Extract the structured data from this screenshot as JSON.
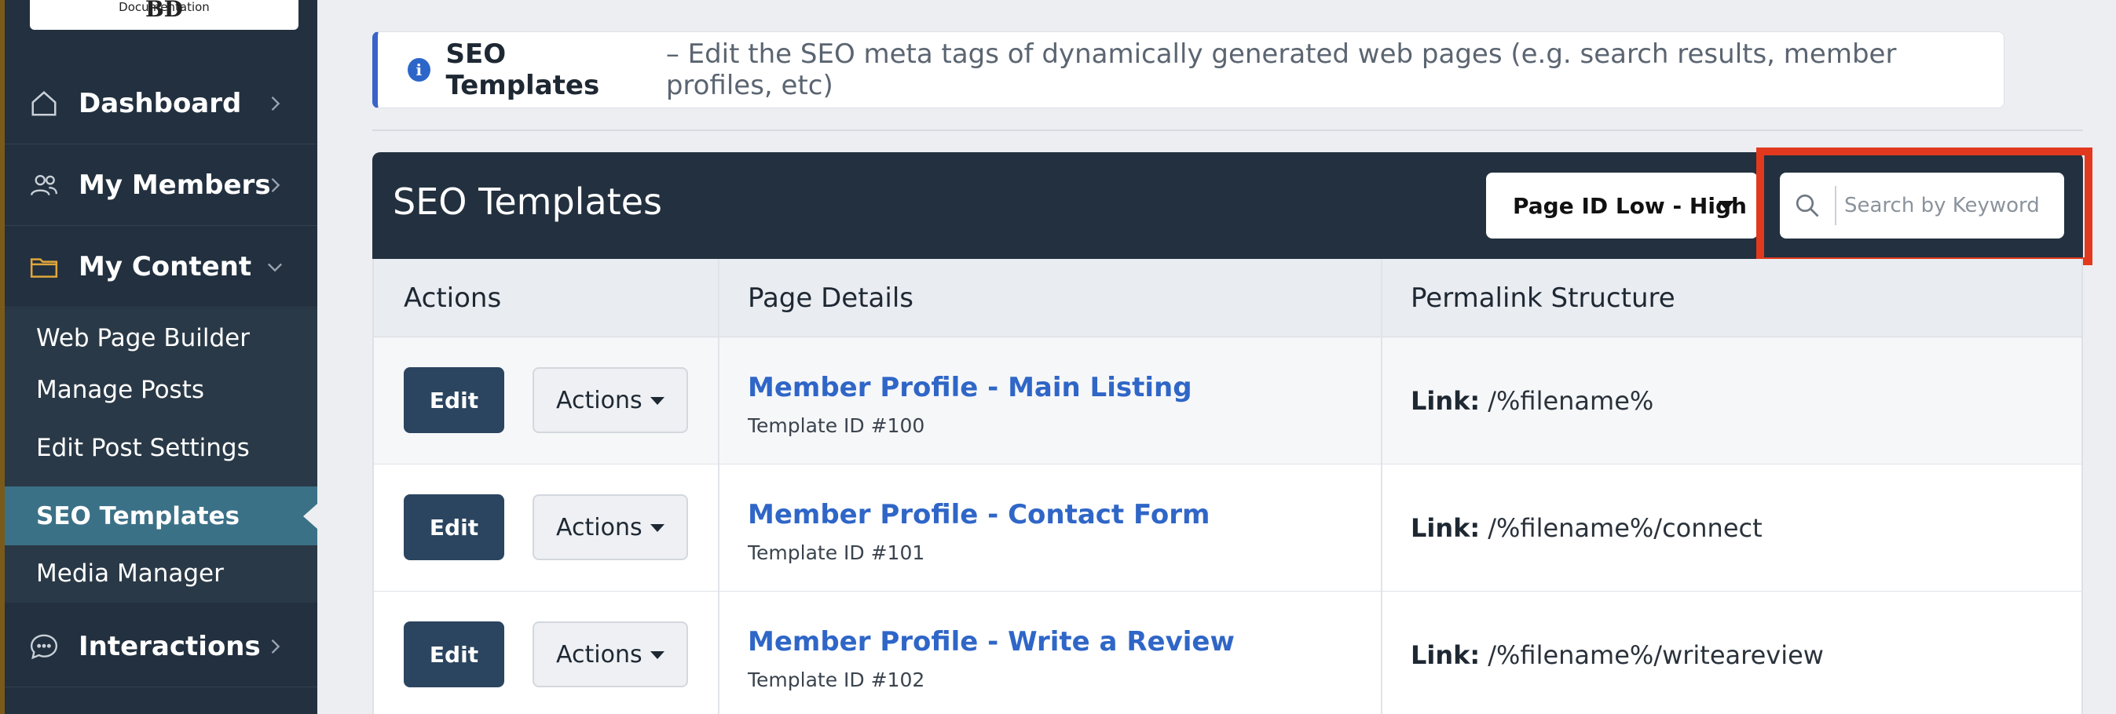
{
  "sidebar": {
    "logo_mark": "BD",
    "logo_sub": "Documentation",
    "nav": [
      {
        "label": "Dashboard",
        "icon": "home-icon",
        "chevron": "chevron-right-icon"
      },
      {
        "label": "My Members",
        "icon": "users-icon",
        "chevron": "chevron-right-icon"
      },
      {
        "label": "My Content",
        "icon": "folder-icon",
        "chevron": "chevron-down-icon"
      },
      {
        "label": "Interactions",
        "icon": "chat-icon",
        "chevron": "chevron-right-icon"
      }
    ],
    "content_items": [
      {
        "label": "Web Page Builder"
      },
      {
        "label": "Manage Posts"
      },
      {
        "label": "Edit Post Settings"
      },
      {
        "label": "SEO Templates",
        "active": true
      },
      {
        "label": "Media Manager"
      }
    ]
  },
  "banner": {
    "title": "SEO Templates",
    "description": "– Edit the SEO meta tags of dynamically generated web pages (e.g. search results, member profiles, etc)"
  },
  "panel": {
    "title": "SEO Templates",
    "sort": {
      "selected": "Page ID Low - High"
    },
    "search": {
      "placeholder": "Search by Keyword",
      "value": ""
    }
  },
  "table": {
    "headers": [
      "Actions",
      "Page Details",
      "Permalink Structure"
    ],
    "edit_label": "Edit",
    "actions_label": "Actions",
    "link_label": "Link:",
    "rows": [
      {
        "name": "Member Profile - Main Listing",
        "template_id": "Template ID #100",
        "link": "/%filename%"
      },
      {
        "name": "Member Profile - Contact Form",
        "template_id": "Template ID #101",
        "link": "/%filename%/connect"
      },
      {
        "name": "Member Profile - Write a Review",
        "template_id": "Template ID #102",
        "link": "/%filename%/writeareview"
      }
    ]
  },
  "colors": {
    "sidebar_bg": "#22303f",
    "active_item": "#3b7186",
    "link": "#2f66c7",
    "edit_button": "#2b4560",
    "highlight": "#e2391e"
  }
}
